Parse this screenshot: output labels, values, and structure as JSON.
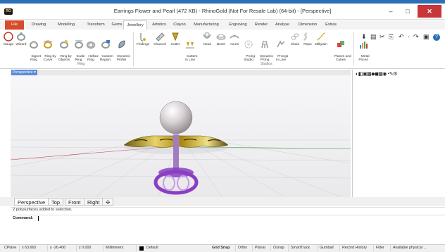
{
  "window": {
    "title": "Earrings Flower and Pearl (472 KB) - RhinoGold (Not For Resale Lab) (64-bit) - [Perspective]",
    "logo_text": "RG",
    "controls": [
      "–",
      "□",
      "✕"
    ]
  },
  "ribbon_tabs": [
    "File",
    "Drawing",
    "Modelling",
    "Transform",
    "Gems",
    "Jewellery",
    "Artistics",
    "Clayoo",
    "Manufacturing",
    "Engraving",
    "Render",
    "Analyse",
    "Dimension",
    "Extras"
  ],
  "active_tab": "Jewellery",
  "ribbon": {
    "ring_tools": [
      {
        "label": "Gauge",
        "icon": "gauge-icon"
      },
      {
        "label": "Wizard",
        "icon": "ring-wizard-icon"
      },
      {
        "label": "Signet\nRing",
        "icon": "signet-ring-icon"
      },
      {
        "label": "Ring by\nCurve",
        "icon": "ring-curve-icon"
      },
      {
        "label": "Ring by\nObjects",
        "icon": "ring-objects-icon"
      },
      {
        "label": "Scale\nRing",
        "icon": "scale-ring-icon"
      },
      {
        "label": "Hollow\nRing",
        "icon": "hollow-ring-icon"
      },
      {
        "label": "Custom\nRegion",
        "icon": "custom-region-icon"
      },
      {
        "label": "Dynamic\nProfile",
        "icon": "dynamic-profile-icon"
      }
    ],
    "studios_tools": [
      {
        "label": "Findings",
        "icon": "findings-icon"
      },
      {
        "label": "Channel",
        "icon": "channel-icon"
      },
      {
        "label": "Cutter",
        "icon": "cutter-icon"
      },
      {
        "label": "Cutters\nin Line",
        "icon": "cutters-line-icon"
      },
      {
        "label": "Head",
        "icon": "head-icon"
      },
      {
        "label": "Bezel",
        "icon": "bezel-icon"
      },
      {
        "label": "Azure",
        "icon": "azure-icon"
      },
      {
        "label": "Prong\nStudio",
        "icon": "prong-studio-icon"
      },
      {
        "label": "Dynamic\nProng",
        "icon": "dynamic-prong-icon"
      },
      {
        "label": "Prongs\nin Line",
        "icon": "prongs-line-icon"
      },
      {
        "label": "Chain",
        "icon": "chain-icon"
      },
      {
        "label": "Rope",
        "icon": "rope-icon"
      },
      {
        "label": "Millgrain",
        "icon": "millgrain-icon"
      },
      {
        "label": "Planes and\nCubes",
        "icon": "planes-cubes-icon"
      }
    ],
    "metal_tool": {
      "label": "Metal\nPrices",
      "icon": "metal-prices-icon"
    },
    "groups": {
      "ring": "Ring",
      "studios": "Studios"
    },
    "quick_access": [
      "⬇",
      "▤",
      "✂",
      "⎘",
      "↶",
      "·",
      "↷",
      "▣",
      "?"
    ]
  },
  "viewport": {
    "name": "Perspective",
    "menu_glyph": "▾"
  },
  "right_panel": {
    "icons": "◐◧▣▩◆◼▦◉◔✎⚙"
  },
  "view_tabs": [
    "Perspective",
    "Top",
    "Front",
    "Right",
    "✣"
  ],
  "active_view_tab": "Perspective",
  "history_text": "2 polysurfaces added to selection.",
  "command": {
    "label": "Command:",
    "value": ""
  },
  "status": {
    "cplane": "CPlane",
    "x": "x 63.665",
    "y": "y -26.406",
    "z": "z 0.000",
    "units": "Millimeters",
    "layer": "Default",
    "toggles": [
      "Grid Snap",
      "Ortho",
      "Planar",
      "Osnap",
      "SmartTrack",
      "Gumball",
      "Record History",
      "Filter"
    ],
    "message": "Available physical ..."
  },
  "colors": {
    "accent": "#2b6fb5",
    "file_tab": "#d64b2b",
    "close_button": "#c7363a",
    "viewport_label": "#5b8ad8",
    "gold": "#b89313",
    "pearl": "#d9d4d6",
    "purple_stud": "#8a3fc2"
  }
}
